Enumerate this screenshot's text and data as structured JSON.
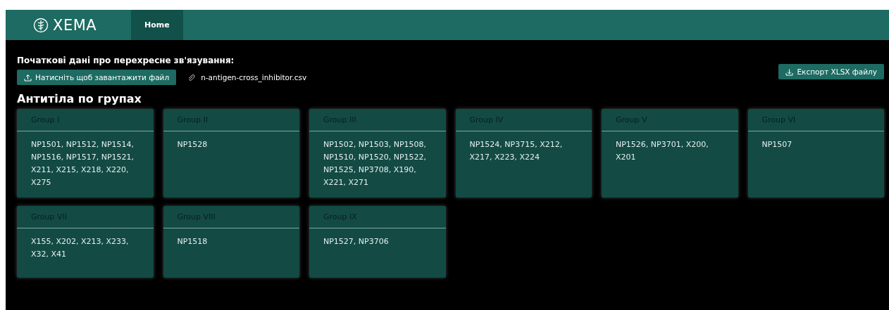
{
  "header": {
    "logo": "XEMA",
    "nav": [
      {
        "label": "Home",
        "selected": true
      }
    ]
  },
  "upload": {
    "label": "Початкові дані про перехресне зв'язування:",
    "button": "Натисніть щоб завантажити файл",
    "file": "n-antigen-cross_inhibitor.csv"
  },
  "export_button": "Експорт XLSX файлу",
  "section_title": "Антитіла по групах",
  "groups": [
    {
      "title": "Group I",
      "antibodies": "NP1501, NP1512, NP1514, NP1516, NP1517, NP1521, X211, X215, X218, X220, X275"
    },
    {
      "title": "Group II",
      "antibodies": "NP1528"
    },
    {
      "title": "Group III",
      "antibodies": "NP1502, NP1503, NP1508, NP1510, NP1520, NP1522, NP1525, NP3708, X190, X221, X271"
    },
    {
      "title": "Group IV",
      "antibodies": "NP1524, NP3715, X212, X217, X223, X224"
    },
    {
      "title": "Group V",
      "antibodies": "NP1526, NP3701, X200, X201"
    },
    {
      "title": "Group VI",
      "antibodies": "NP1507"
    },
    {
      "title": "Group VII",
      "antibodies": "X155, X202, X213, X233, X32, X41"
    },
    {
      "title": "Group VIII",
      "antibodies": "NP1518"
    },
    {
      "title": "Group IX",
      "antibodies": "NP1527, NP3706"
    }
  ]
}
